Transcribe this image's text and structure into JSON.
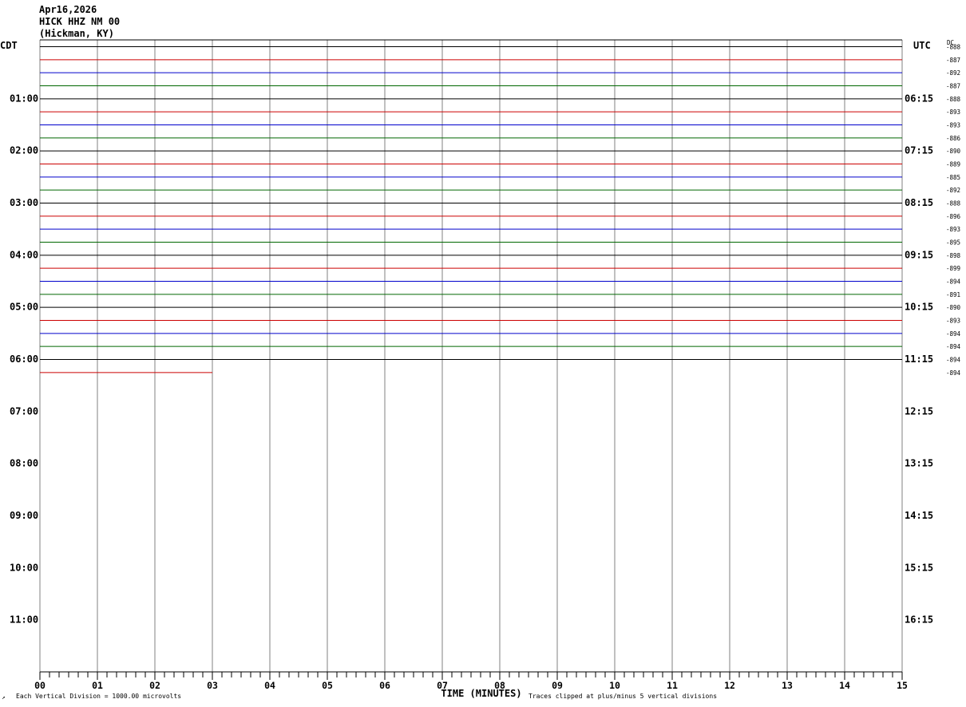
{
  "chart_data": {
    "type": "line",
    "header": {
      "date": "Apr16,2026",
      "station": "HICK HHZ NM 00",
      "location": "(Hickman, KY)"
    },
    "left_axis_label": "CDT",
    "right_axis_label": "UTC",
    "dc_label": "DC",
    "xlabel": "TIME (MINUTES)",
    "xlim": [
      0,
      15
    ],
    "x_ticks": [
      "00",
      "01",
      "02",
      "03",
      "04",
      "05",
      "06",
      "07",
      "08",
      "09",
      "10",
      "11",
      "12",
      "13",
      "14",
      "15"
    ],
    "row_minutes": 15,
    "rows_total": 48,
    "hour_labels_left": [
      "01:00",
      "02:00",
      "03:00",
      "04:00",
      "05:00",
      "06:00",
      "07:00",
      "08:00",
      "09:00",
      "10:00",
      "11:00"
    ],
    "hour_labels_right": [
      "06:15",
      "07:15",
      "08:15",
      "09:15",
      "10:15",
      "11:15",
      "12:15",
      "13:15",
      "14:15",
      "15:15",
      "16:15"
    ],
    "trace_colors": [
      "#000000",
      "#cc0000",
      "#0000cc",
      "#006600"
    ],
    "traces": [
      {
        "row": 0,
        "end_minute": 15,
        "dc": "-888"
      },
      {
        "row": 1,
        "end_minute": 15,
        "dc": "-887"
      },
      {
        "row": 2,
        "end_minute": 15,
        "dc": "-892"
      },
      {
        "row": 3,
        "end_minute": 15,
        "dc": "-887"
      },
      {
        "row": 4,
        "end_minute": 15,
        "dc": "-888"
      },
      {
        "row": 5,
        "end_minute": 15,
        "dc": "-893"
      },
      {
        "row": 6,
        "end_minute": 15,
        "dc": "-893"
      },
      {
        "row": 7,
        "end_minute": 15,
        "dc": "-886"
      },
      {
        "row": 8,
        "end_minute": 15,
        "dc": "-890"
      },
      {
        "row": 9,
        "end_minute": 15,
        "dc": "-889"
      },
      {
        "row": 10,
        "end_minute": 15,
        "dc": "-885"
      },
      {
        "row": 11,
        "end_minute": 15,
        "dc": "-892"
      },
      {
        "row": 12,
        "end_minute": 15,
        "dc": "-888"
      },
      {
        "row": 13,
        "end_minute": 15,
        "dc": "-896"
      },
      {
        "row": 14,
        "end_minute": 15,
        "dc": "-893"
      },
      {
        "row": 15,
        "end_minute": 15,
        "dc": "-895"
      },
      {
        "row": 16,
        "end_minute": 15,
        "dc": "-898"
      },
      {
        "row": 17,
        "end_minute": 15,
        "dc": "-899"
      },
      {
        "row": 18,
        "end_minute": 15,
        "dc": "-894"
      },
      {
        "row": 19,
        "end_minute": 15,
        "dc": "-891"
      },
      {
        "row": 20,
        "end_minute": 15,
        "dc": "-890"
      },
      {
        "row": 21,
        "end_minute": 15,
        "dc": "-893"
      },
      {
        "row": 22,
        "end_minute": 15,
        "dc": "-894"
      },
      {
        "row": 23,
        "end_minute": 15,
        "dc": "-894"
      },
      {
        "row": 24,
        "end_minute": 15,
        "dc": "-894"
      },
      {
        "row": 25,
        "end_minute": 3,
        "dc": "-894"
      }
    ],
    "footer_left": "Each Vertical Division = 1000.00 microvolts",
    "footer_right": "Traces clipped at plus/minus 5 vertical divisions"
  }
}
